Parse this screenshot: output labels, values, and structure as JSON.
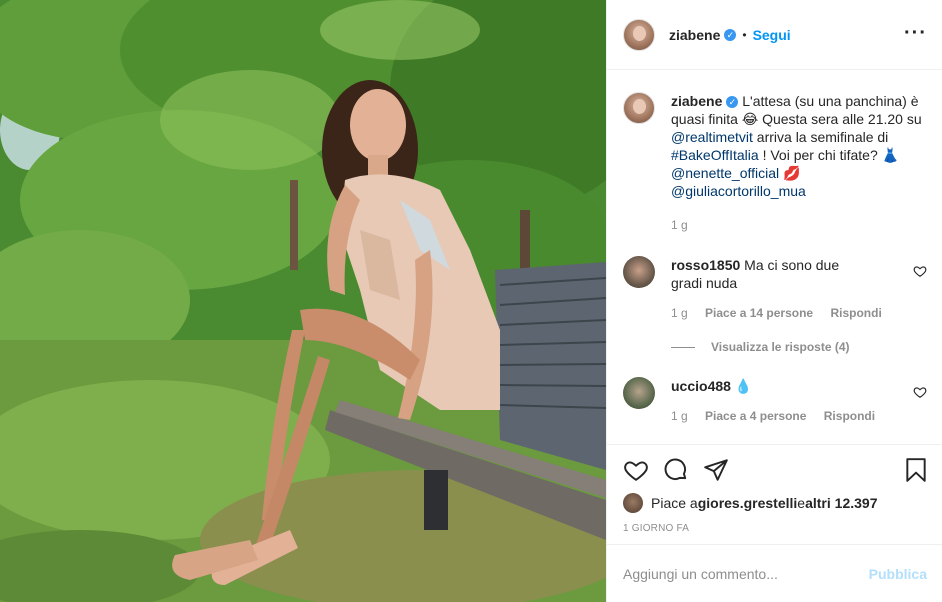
{
  "post": {
    "image_alt": "",
    "author": {
      "username": "ziabene",
      "verified": true,
      "follow_label": "Segui",
      "separator": "•"
    },
    "more_icon": "more-horizontal-icon",
    "caption": {
      "username": "ziabene",
      "text_1": " L'attesa (su una panchina) è quasi finita 😂 Questa sera alle 21.20 su ",
      "mention_1": "@realtimetvit",
      "text_2": " arriva la semifinale di ",
      "hashtag_1": "#BakeOffItalia",
      "text_3": " ! Voi per chi tifate? 👗 ",
      "mention_2": "@nenette_official",
      "text_4": " 💋 ",
      "mention_3": "@giuliacortorillo_mua",
      "time": "1 g"
    },
    "comments": [
      {
        "username": "rosso1850",
        "text": "Ma ci sono due gradi nuda",
        "time": "1 g",
        "likes": "Piace a 14 persone",
        "reply_label": "Rispondi",
        "view_replies": "Visualizza le risposte (4)"
      },
      {
        "username": "uccio488",
        "text": "💧",
        "time": "1 g",
        "likes": "Piace a 4 persone",
        "reply_label": "Rispondi"
      }
    ],
    "actions": {
      "like_icon": "heart-icon",
      "comment_icon": "comment-icon",
      "share_icon": "share-icon",
      "save_icon": "bookmark-icon"
    },
    "likes": {
      "prefix": "Piace a ",
      "user": "giores.grestelli",
      "middle": " e ",
      "others": "altri 12.397"
    },
    "time_ago": "1 GIORNO FA",
    "add_comment": {
      "placeholder": "Aggiungi un commento...",
      "publish_label": "Pubblica"
    }
  },
  "colors": {
    "accent": "#0095f6",
    "publish_disabled": "#b2dffc",
    "muted": "#8e8e8e",
    "text": "#262626",
    "verified": "#3897f0"
  }
}
